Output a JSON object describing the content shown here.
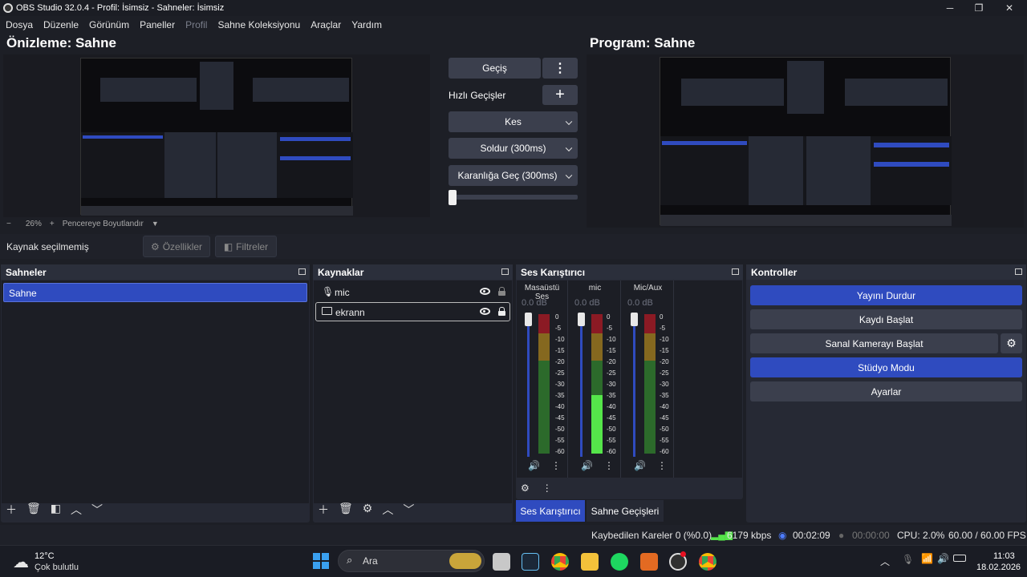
{
  "window": {
    "title": "OBS Studio 32.0.4 - Profil: İsimsiz - Sahneler: İsimsiz"
  },
  "menu": [
    "Dosya",
    "Düzenle",
    "Görünüm",
    "Paneller",
    "Profil",
    "Sahne Koleksiyonu",
    "Araçlar",
    "Yardım"
  ],
  "preview": {
    "title": "Önizleme: Sahne",
    "zoom": "26%",
    "zoom_minus": "−",
    "zoom_plus": "+",
    "fit_label": "Pencereye Boyutlandır"
  },
  "program": {
    "title": "Program: Sahne"
  },
  "transitions": {
    "transition_button": "Geçiş",
    "quick_label": "Hızlı Geçişler",
    "items": [
      "Kes",
      "Soldur (300ms)",
      "Karanlığa Geç (300ms)"
    ]
  },
  "source_toolbar": {
    "no_source": "Kaynak seçilmemiş",
    "properties": "Özellikler",
    "filters": "Filtreler"
  },
  "scenes": {
    "title": "Sahneler",
    "items": [
      "Sahne"
    ]
  },
  "sources": {
    "title": "Kaynaklar",
    "items": [
      {
        "name": "mic",
        "locked": false
      },
      {
        "name": "ekrann",
        "locked": true
      }
    ]
  },
  "mixer": {
    "title": "Ses Karıştırıcı",
    "channels": [
      {
        "name": "Masaüstü Ses",
        "db": "0.0 dB",
        "level": 0,
        "slider": 1.0
      },
      {
        "name": "mic",
        "db": "0.0 dB",
        "level": 0.42,
        "slider": 1.0
      },
      {
        "name": "Mic/Aux",
        "db": "0.0 dB",
        "level": 0,
        "slider": 1.0
      }
    ],
    "ticks": [
      "0",
      "-5",
      "-10",
      "-15",
      "-20",
      "-25",
      "-30",
      "-35",
      "-40",
      "-45",
      "-50",
      "-55",
      "-60"
    ],
    "tabs": [
      "Ses Karıştırıcı",
      "Sahne Geçişleri"
    ]
  },
  "controls": {
    "title": "Kontroller",
    "stop_stream": "Yayını Durdur",
    "start_record": "Kaydı Başlat",
    "virtual_cam": "Sanal Kamerayı Başlat",
    "studio_mode": "Stüdyo Modu",
    "settings": "Ayarlar"
  },
  "status": {
    "dropped": "Kaybedilen Kareler 0 (%0.0)",
    "bitrate": "6179 kbps",
    "stream_time": "00:02:09",
    "record_time": "00:00:00",
    "cpu": "CPU: 2.0%",
    "fps": "60.00 / 60.00 FPS"
  },
  "taskbar": {
    "weather_temp": "12°C",
    "weather_desc": "Çok bulutlu",
    "search": "Ara",
    "time": "11:03",
    "date": "18.02.2026"
  },
  "colors": {
    "accent": "#2f4bbf",
    "panel": "#262934",
    "bg": "#1d1f26"
  }
}
